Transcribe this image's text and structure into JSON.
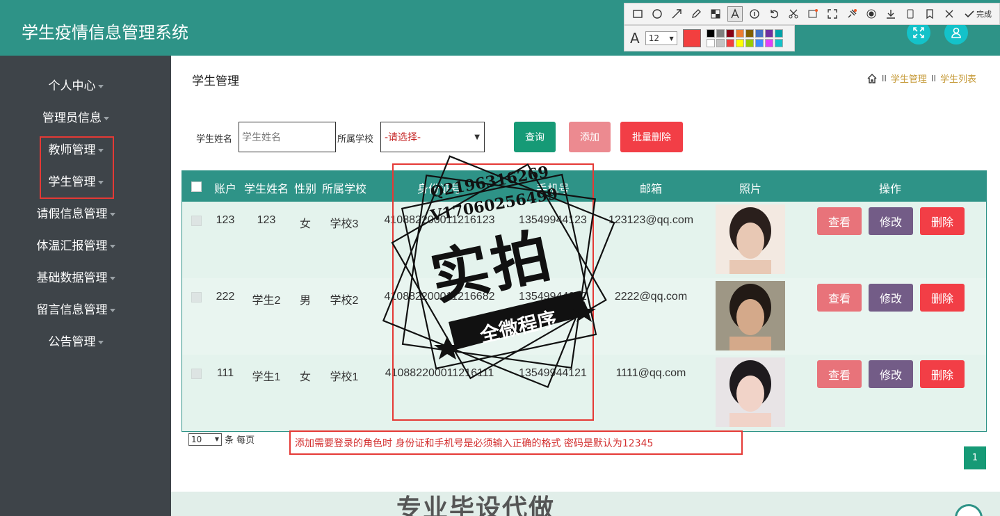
{
  "app": {
    "title": "学生疫情信息管理系统"
  },
  "annotation_toolbar": {
    "tools": [
      "rect-tool-icon",
      "ellipse-tool-icon",
      "arrow-tool-icon",
      "pen-tool-icon",
      "mosaic-tool-icon",
      "text-tool-icon",
      "number-tool-icon",
      "undo-icon",
      "cut-icon",
      "ocr-icon",
      "scale-icon",
      "pin-icon",
      "record-icon",
      "download-icon",
      "phone-icon",
      "bookmark-icon",
      "close-icon"
    ],
    "done_label": "完成",
    "font_size": "12",
    "current_color": "#f23f3f",
    "palette": [
      "#000000",
      "#7f7f7f",
      "#880015",
      "#ed7d31",
      "#7f5f00",
      "#4472c4",
      "#7030a0",
      "#00a2a8",
      "#ffffff",
      "#c3c3c3",
      "#f23f3f",
      "#ffff00",
      "#99cc00",
      "#3d8bff",
      "#e040fb",
      "#14c2c9"
    ]
  },
  "sidebar": {
    "items": [
      {
        "label": "个人中心"
      },
      {
        "label": "管理员信息"
      },
      {
        "label": "教师管理"
      },
      {
        "label": "学生管理"
      },
      {
        "label": "请假信息管理"
      },
      {
        "label": "体温汇报管理"
      },
      {
        "label": "基础数据管理"
      },
      {
        "label": "留言信息管理"
      },
      {
        "label": "公告管理"
      }
    ]
  },
  "main": {
    "title": "学生管理",
    "breadcrumb": {
      "sep": "II",
      "items": [
        "学生管理",
        "学生列表"
      ]
    }
  },
  "search": {
    "name_label": "学生姓名",
    "name_placeholder": "学生姓名",
    "school_label": "所属学校",
    "school_value": "-请选择-",
    "query_label": "查询",
    "add_label": "添加",
    "batch_delete_label": "批量删除"
  },
  "table": {
    "columns": [
      "账户",
      "学生姓名",
      "性别",
      "所属学校",
      "身份证号",
      "手机号",
      "邮箱",
      "照片",
      "操作"
    ],
    "rows": [
      {
        "account": "123",
        "name": "123",
        "gender": "女",
        "school": "学校3",
        "id_card": "410882200011216123",
        "phone": "13549944123",
        "email": "123123@qq.com"
      },
      {
        "account": "222",
        "name": "学生2",
        "gender": "男",
        "school": "学校2",
        "id_card": "410882200011216682",
        "phone": "13549944682",
        "email": "2222@qq.com"
      },
      {
        "account": "111",
        "name": "学生1",
        "gender": "女",
        "school": "学校1",
        "id_card": "410882200011216111",
        "phone": "13549944121",
        "email": "1111@qq.com"
      }
    ],
    "actions": {
      "view": "查看",
      "edit": "修改",
      "delete": "删除"
    }
  },
  "pagination": {
    "page_size": "10",
    "per_page_label": "条 每页",
    "current_page": "1"
  },
  "notice": "添加需要登录的角色时 身份证和手机号是必须输入正确的格式  密码是默认为12345",
  "watermark": {
    "line1": "Q2196316269",
    "line2": "V17060256499",
    "big": "实拍",
    "ribbon": "全微程序"
  },
  "bottom_banner": "专业毕设代做"
}
